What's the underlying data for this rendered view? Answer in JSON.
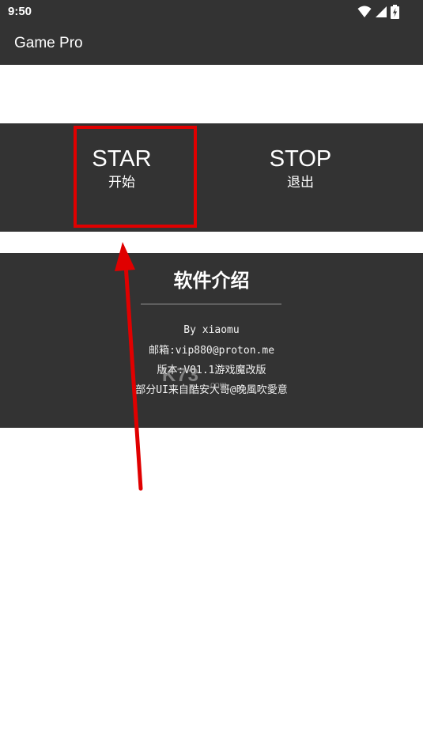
{
  "status_bar": {
    "time": "9:50",
    "icons": [
      "wifi-icon",
      "signal-icon",
      "battery-charging-icon"
    ]
  },
  "app_bar": {
    "title": "Game Pro"
  },
  "controls": {
    "start": {
      "label": "STAR",
      "sublabel": "开始"
    },
    "stop": {
      "label": "STOP",
      "sublabel": "退出"
    }
  },
  "info": {
    "title": "软件介绍",
    "lines": [
      "By xiaomu",
      "邮箱:vip880@proton.me",
      "版本:V01.1游戏魔改版",
      "部分UI来自酷安大哥@晚風吹愛意"
    ]
  },
  "watermark": {
    "text": "K73",
    "subtext": ".com"
  },
  "colors": {
    "bar_background": "#333333",
    "panel_background": "#333333",
    "page_background": "#ffffff",
    "highlight": "#e00000",
    "arrow": "#e00000"
  }
}
